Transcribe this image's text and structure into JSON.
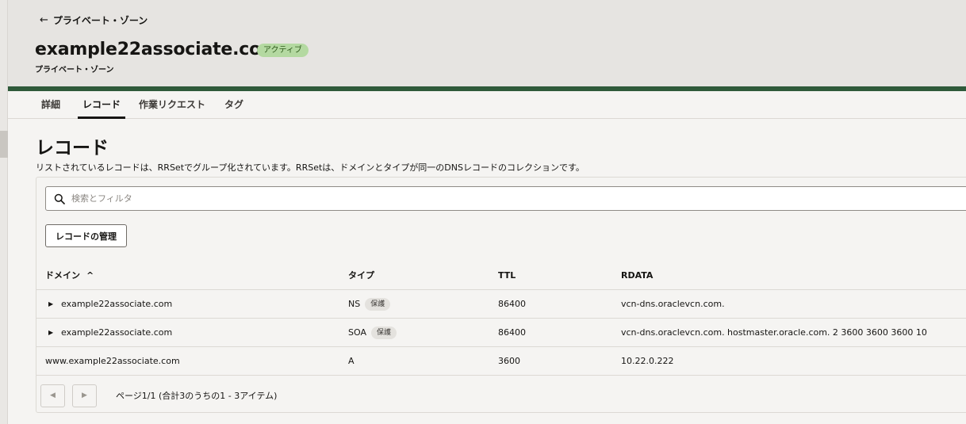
{
  "header": {
    "back_label": "プライベート・ゾーン",
    "zone_name": "example22associate.com",
    "status": "アクティブ",
    "subtitle": "プライベート・ゾーン"
  },
  "tabs": [
    {
      "label": "詳細",
      "active": false
    },
    {
      "label": "レコード",
      "active": true
    },
    {
      "label": "作業リクエスト",
      "active": false
    },
    {
      "label": "タグ",
      "active": false
    }
  ],
  "section": {
    "title": "レコード",
    "description": "リストされているレコードは、RRSetでグループ化されています。RRSetは、ドメインとタイプが同一のDNSレコードのコレクションです。"
  },
  "search": {
    "placeholder": "検索とフィルタ"
  },
  "manage_button": "レコードの管理",
  "table": {
    "columns": [
      "ドメイン",
      "タイプ",
      "TTL",
      "RDATA"
    ],
    "sort_indicator": "^",
    "rows": [
      {
        "domain": "example22associate.com",
        "expandable": true,
        "type": "NS",
        "tag": "保護",
        "ttl": "86400",
        "rdata": "vcn-dns.oraclevcn.com."
      },
      {
        "domain": "example22associate.com",
        "expandable": true,
        "type": "SOA",
        "tag": "保護",
        "ttl": "86400",
        "rdata": "vcn-dns.oraclevcn.com. hostmaster.oracle.com. 2 3600 3600 3600 10"
      },
      {
        "domain": "www.example22associate.com",
        "expandable": false,
        "type": "A",
        "tag": "",
        "ttl": "3600",
        "rdata": "10.22.0.222"
      }
    ]
  },
  "pagination": {
    "prev_icon": "chevron-left-icon",
    "next_icon": "chevron-right-icon",
    "text": "ページ1/1 (合計3のうちの1 - 3アイテム)"
  },
  "colors": {
    "status_badge_bg": "#b4d9a1",
    "banner": "#2f5a3a",
    "header_bg": "#e6e4e1"
  }
}
